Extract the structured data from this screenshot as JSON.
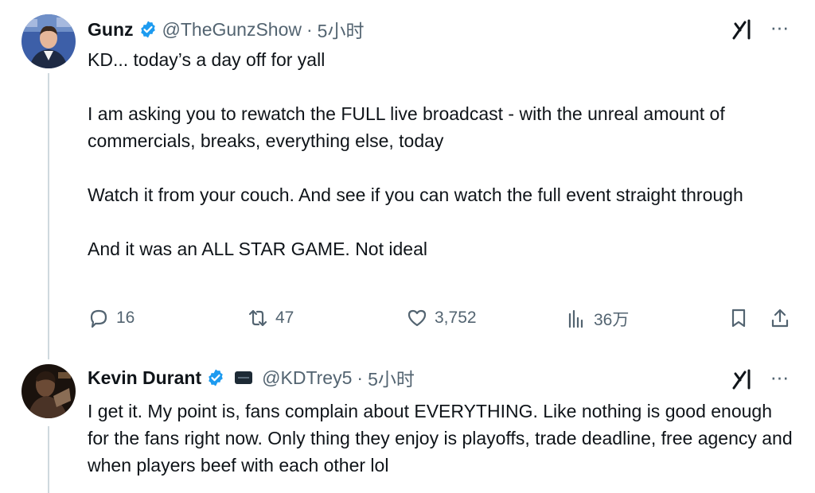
{
  "tweets": [
    {
      "author": {
        "name": "Gunz",
        "handle": "@TheGunzShow",
        "verified": true,
        "avatar": "portrait-man-suit"
      },
      "time": "5小时",
      "paragraphs": [
        "KD... today’s a day off for yall",
        "I am asking you to rewatch the FULL live broadcast - with the unreal amount of commercials, breaks, everything else, today",
        "Watch it from your couch. And see if you can watch the full event straight through",
        "And it was an ALL STAR GAME.  Not ideal"
      ],
      "actions": {
        "replies": "16",
        "reposts": "47",
        "likes": "3,752",
        "views": "36万"
      }
    },
    {
      "author": {
        "name": "Kevin Durant",
        "handle": "@KDTrey5",
        "verified": true,
        "affiliate_badge": "organization-badge",
        "avatar": "portrait-dark-background"
      },
      "time": "5小时",
      "paragraphs": [
        "I get it. My point is, fans complain about EVERYTHING. Like nothing is good enough for the fans right now. Only thing they enjoy is playoffs, trade deadline, free agency and when players beef with each other lol"
      ]
    }
  ],
  "ui": {
    "separator": "·",
    "more": "···",
    "colors": {
      "text": "#0f1419",
      "secondary": "#536471",
      "verified": "#1d9bf0",
      "thread_line": "#cfd9de"
    }
  }
}
